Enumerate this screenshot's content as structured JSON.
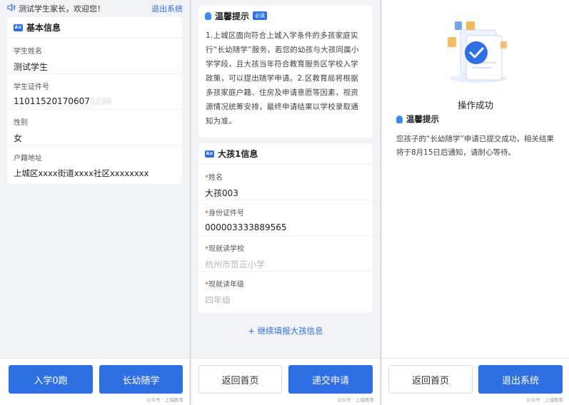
{
  "panel1": {
    "greeting": "测试学生家长，欢迎您！",
    "logout_link": "退出系统",
    "card_title": "基本信息",
    "fields": [
      {
        "label": "学生姓名",
        "value": "测试学生"
      },
      {
        "label": "学生证件号",
        "value": "11011520170607",
        "value_blurred": "1234"
      },
      {
        "label": "性别",
        "value": "女"
      },
      {
        "label": "户籍地址",
        "value": "上城区xxxx街道xxxx社区xxxxxxxx"
      }
    ],
    "buttons": {
      "left": "入学0跑",
      "right": "长幼随学"
    },
    "watermark": "公众号 · 上城教育"
  },
  "panel2": {
    "tip_title": "温馨提示",
    "tip_tag": "必读",
    "tip_text": "1.上城区面向符合上城入学条件的多孩家庭实行“长幼随学”服务，若您的幼孩与大孩同属小学学段，且大孩当年符合教育服务区学校入学政策，可以提出随学申请。2.区教育局将根据多孩家庭户籍、住房及申请意愿等因素，视资源情况统筹安排，最终申请结果以学校录取通知为准。",
    "card_title": "大孩1信息",
    "fields": [
      {
        "label": "姓名",
        "value": "大孩003"
      },
      {
        "label": "身份证件号",
        "value": "000003333889565"
      },
      {
        "label": "现就读学校",
        "value": "杭州市笕正小学"
      },
      {
        "label": "现就读年级",
        "value": "四年级"
      }
    ],
    "add_link": "+ 继续填报大孩信息",
    "buttons": {
      "left": "返回首页",
      "right": "递交申请"
    },
    "watermark": "公众号 · 上城教育"
  },
  "panel3": {
    "success_text": "操作成功",
    "tip_title": "温馨提示",
    "tip_text": "您孩子的“长幼随学”申请已提交成功，相关结果将于8月15日后通知，请耐心等待。",
    "buttons": {
      "left": "返回首页",
      "right": "退出系统"
    },
    "watermark": "公众号 · 上城教育"
  },
  "colors": {
    "accent": "#2f6fe4",
    "required": "#e03c31"
  },
  "icons": [
    "speaker-icon",
    "id-card-icon",
    "lightbulb-icon",
    "success-check-icon"
  ]
}
